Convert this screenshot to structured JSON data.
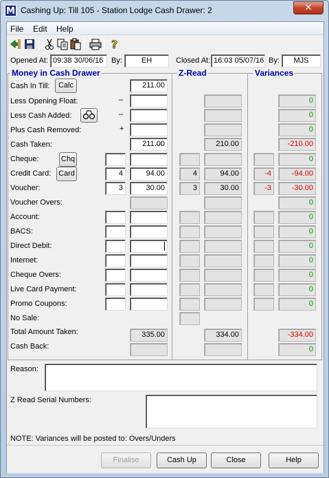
{
  "window": {
    "title": "Cashing Up: Till 105 - Station Lodge  Cash Drawer: 2",
    "app_icon_letter": "M",
    "close_glyph": "✕"
  },
  "menu": [
    "File",
    "Edit",
    "Help"
  ],
  "toolbar_icons": [
    "exit-icon",
    "save-icon",
    "cut-icon",
    "copy-icon",
    "paste-icon",
    "print-icon",
    "help-icon"
  ],
  "info": {
    "opened_label": "Opened At:",
    "opened_value": "09:38 30/06/16",
    "opened_by_label": "By:",
    "opened_by_value": "EH",
    "closed_label": "Closed At:",
    "closed_value": "16:03 05/07/16",
    "closed_by_label": "By:",
    "closed_by_value": "MJS"
  },
  "headers": {
    "money": "Money in Cash Drawer",
    "zread": "Z-Read",
    "variances": "Variances"
  },
  "rows": {
    "cash_in_till": {
      "label": "Cash In Till:",
      "button": "Calc",
      "amount": "211.00"
    },
    "less_opening": {
      "label": "Less Opening Float:",
      "sign": "–"
    },
    "less_cash_added": {
      "label": "Less Cash Added:",
      "sign": "–"
    },
    "plus_cash_removed": {
      "label": "Plus Cash Removed:",
      "sign": "+"
    },
    "cash_taken": {
      "label": "Cash Taken:",
      "amount": "211.00",
      "zread": "210.00",
      "variance": "-210.00"
    },
    "cheque": {
      "label": "Cheque:",
      "button": "Chq"
    },
    "credit_card": {
      "label": "Credit Card:",
      "button": "Card",
      "count": "4",
      "amount": "94.00",
      "z_count": "4",
      "zread": "94.00",
      "v_count": "-4",
      "variance": "-94.00"
    },
    "voucher": {
      "label": "Voucher:",
      "count": "3",
      "amount": "30.00",
      "z_count": "3",
      "zread": "30.00",
      "v_count": "-3",
      "variance": "-30.00"
    },
    "voucher_overs": {
      "label": "Voucher Overs:"
    },
    "account": {
      "label": "Account:"
    },
    "bacs": {
      "label": "BACS:"
    },
    "direct_debit": {
      "label": "Direct Debit:"
    },
    "internet": {
      "label": "Internet:"
    },
    "cheque_overs": {
      "label": "Cheque Overs:"
    },
    "live_card": {
      "label": "Live Card Payment:"
    },
    "promo": {
      "label": "Promo Coupons:"
    },
    "no_sale": {
      "label": "No Sale:"
    },
    "total": {
      "label": "Total Amount Taken:",
      "amount": "335.00",
      "zread": "334.00",
      "variance": "-334.00"
    },
    "cash_back": {
      "label": "Cash Back:"
    }
  },
  "zero": "0",
  "reason_label": "Reason:",
  "zread_serial_label": "Z Read Serial Numbers:",
  "note": "NOTE: Variances will be posted to: Overs/Unders",
  "buttons": {
    "finalise": "Finalise",
    "cash_up": "Cash Up",
    "close": "Close",
    "help": "Help"
  },
  "colors": {
    "variance_zero": "#00a000",
    "variance_negative": "#e00000",
    "header": "#0000a8"
  }
}
